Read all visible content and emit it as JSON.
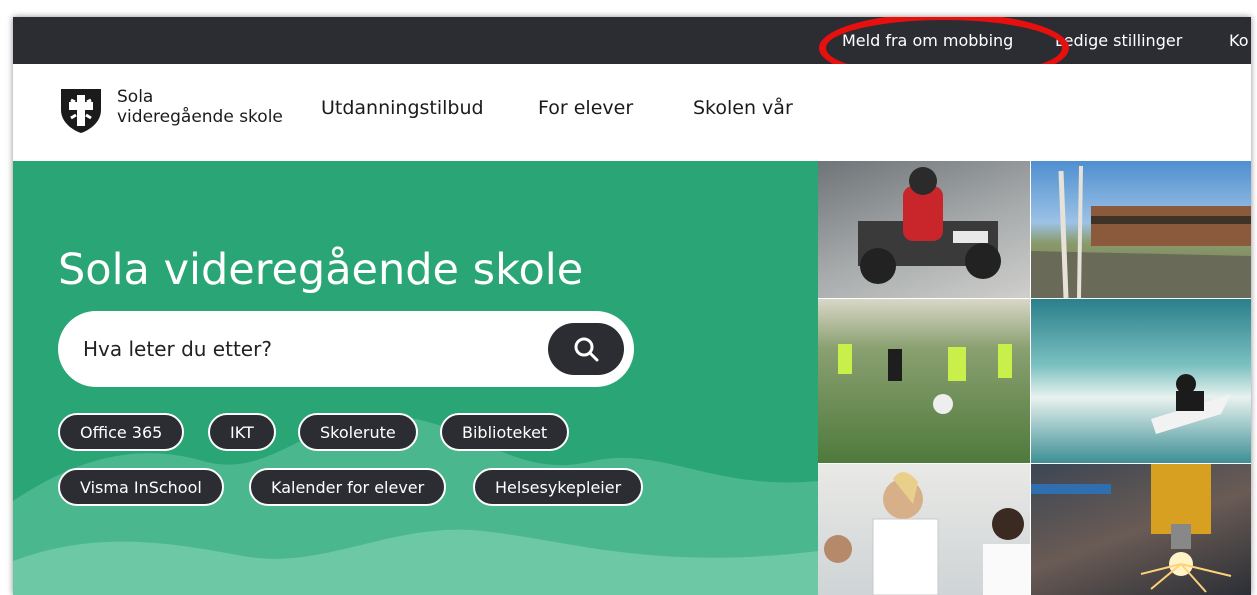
{
  "topbar": {
    "items": [
      {
        "label": "Meld fra om mobbing"
      },
      {
        "label": "Ledige stillinger"
      },
      {
        "label": "Ko"
      }
    ]
  },
  "header": {
    "logo_line1": "Sola",
    "logo_line2": "videregående skole",
    "nav": [
      {
        "label": "Utdanningstilbud"
      },
      {
        "label": "For elever"
      },
      {
        "label": "Skolen vår"
      }
    ]
  },
  "hero": {
    "title": "Sola videregående skole",
    "search_placeholder": "Hva leter du etter?",
    "quicklinks": [
      {
        "label": "Office 365"
      },
      {
        "label": "IKT"
      },
      {
        "label": "Skolerute"
      },
      {
        "label": "Biblioteket"
      },
      {
        "label": "Visma InSchool"
      },
      {
        "label": "Kalender for elever"
      },
      {
        "label": "Helsesykepleier"
      }
    ]
  },
  "photos": [
    {
      "subject": "go-kart-race"
    },
    {
      "subject": "school-building"
    },
    {
      "subject": "football-practice"
    },
    {
      "subject": "surfing"
    },
    {
      "subject": "science-class"
    },
    {
      "subject": "metal-cutting"
    }
  ],
  "colors": {
    "topbar_bg": "#2b2d33",
    "hero_green": "#2aa576",
    "highlight_red": "#e8100f"
  }
}
